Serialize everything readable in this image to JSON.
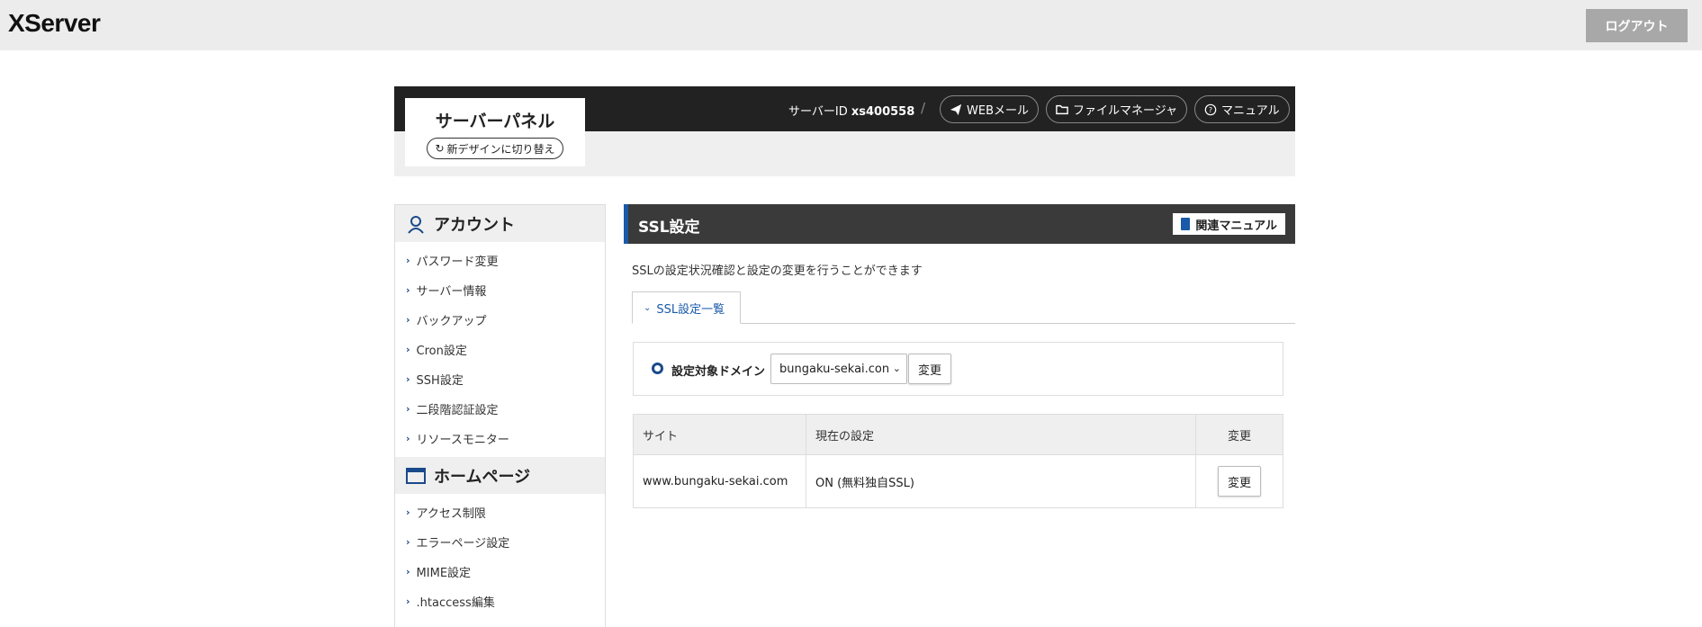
{
  "topbar": {
    "logo": "XServer",
    "logout_label": "ログアウト"
  },
  "panel": {
    "title": "サーバーパネル",
    "switch_label": "新デザインに切り替え",
    "server_id_label": "サーバーID",
    "server_id": "xs400558",
    "separator": "/",
    "buttons": [
      {
        "label": "WEBメール",
        "icon": "send-icon"
      },
      {
        "label": "ファイルマネージャ",
        "icon": "folder-icon"
      },
      {
        "label": "マニュアル",
        "icon": "help-icon"
      }
    ]
  },
  "sidebar": {
    "account": {
      "title": "アカウント",
      "items": [
        "パスワード変更",
        "サーバー情報",
        "バックアップ",
        "Cron設定",
        "SSH設定",
        "二段階認証設定",
        "リソースモニター"
      ]
    },
    "homepage": {
      "title": "ホームページ",
      "items": [
        "アクセス制限",
        "エラーページ設定",
        "MIME設定",
        ".htaccess編集"
      ]
    }
  },
  "main": {
    "title": "SSL設定",
    "manual_label": "関連マニュアル",
    "description": "SSLの設定状況確認と設定の変更を行うことができます",
    "tab_label": "SSL設定一覧",
    "domain": {
      "label": "設定対象ドメイン",
      "selected": "bungaku-sekai.con",
      "change_label": "変更"
    },
    "table": {
      "headers": [
        "サイト",
        "現在の設定",
        "変更"
      ],
      "rows": [
        {
          "site": "www.bungaku-sekai.com",
          "setting": "ON (無料独自SSL)",
          "change_label": "変更"
        }
      ]
    }
  },
  "colors": {
    "accent": "#1a5aa8",
    "header_dark": "#222222",
    "logout_bg": "#a8a8a8"
  }
}
